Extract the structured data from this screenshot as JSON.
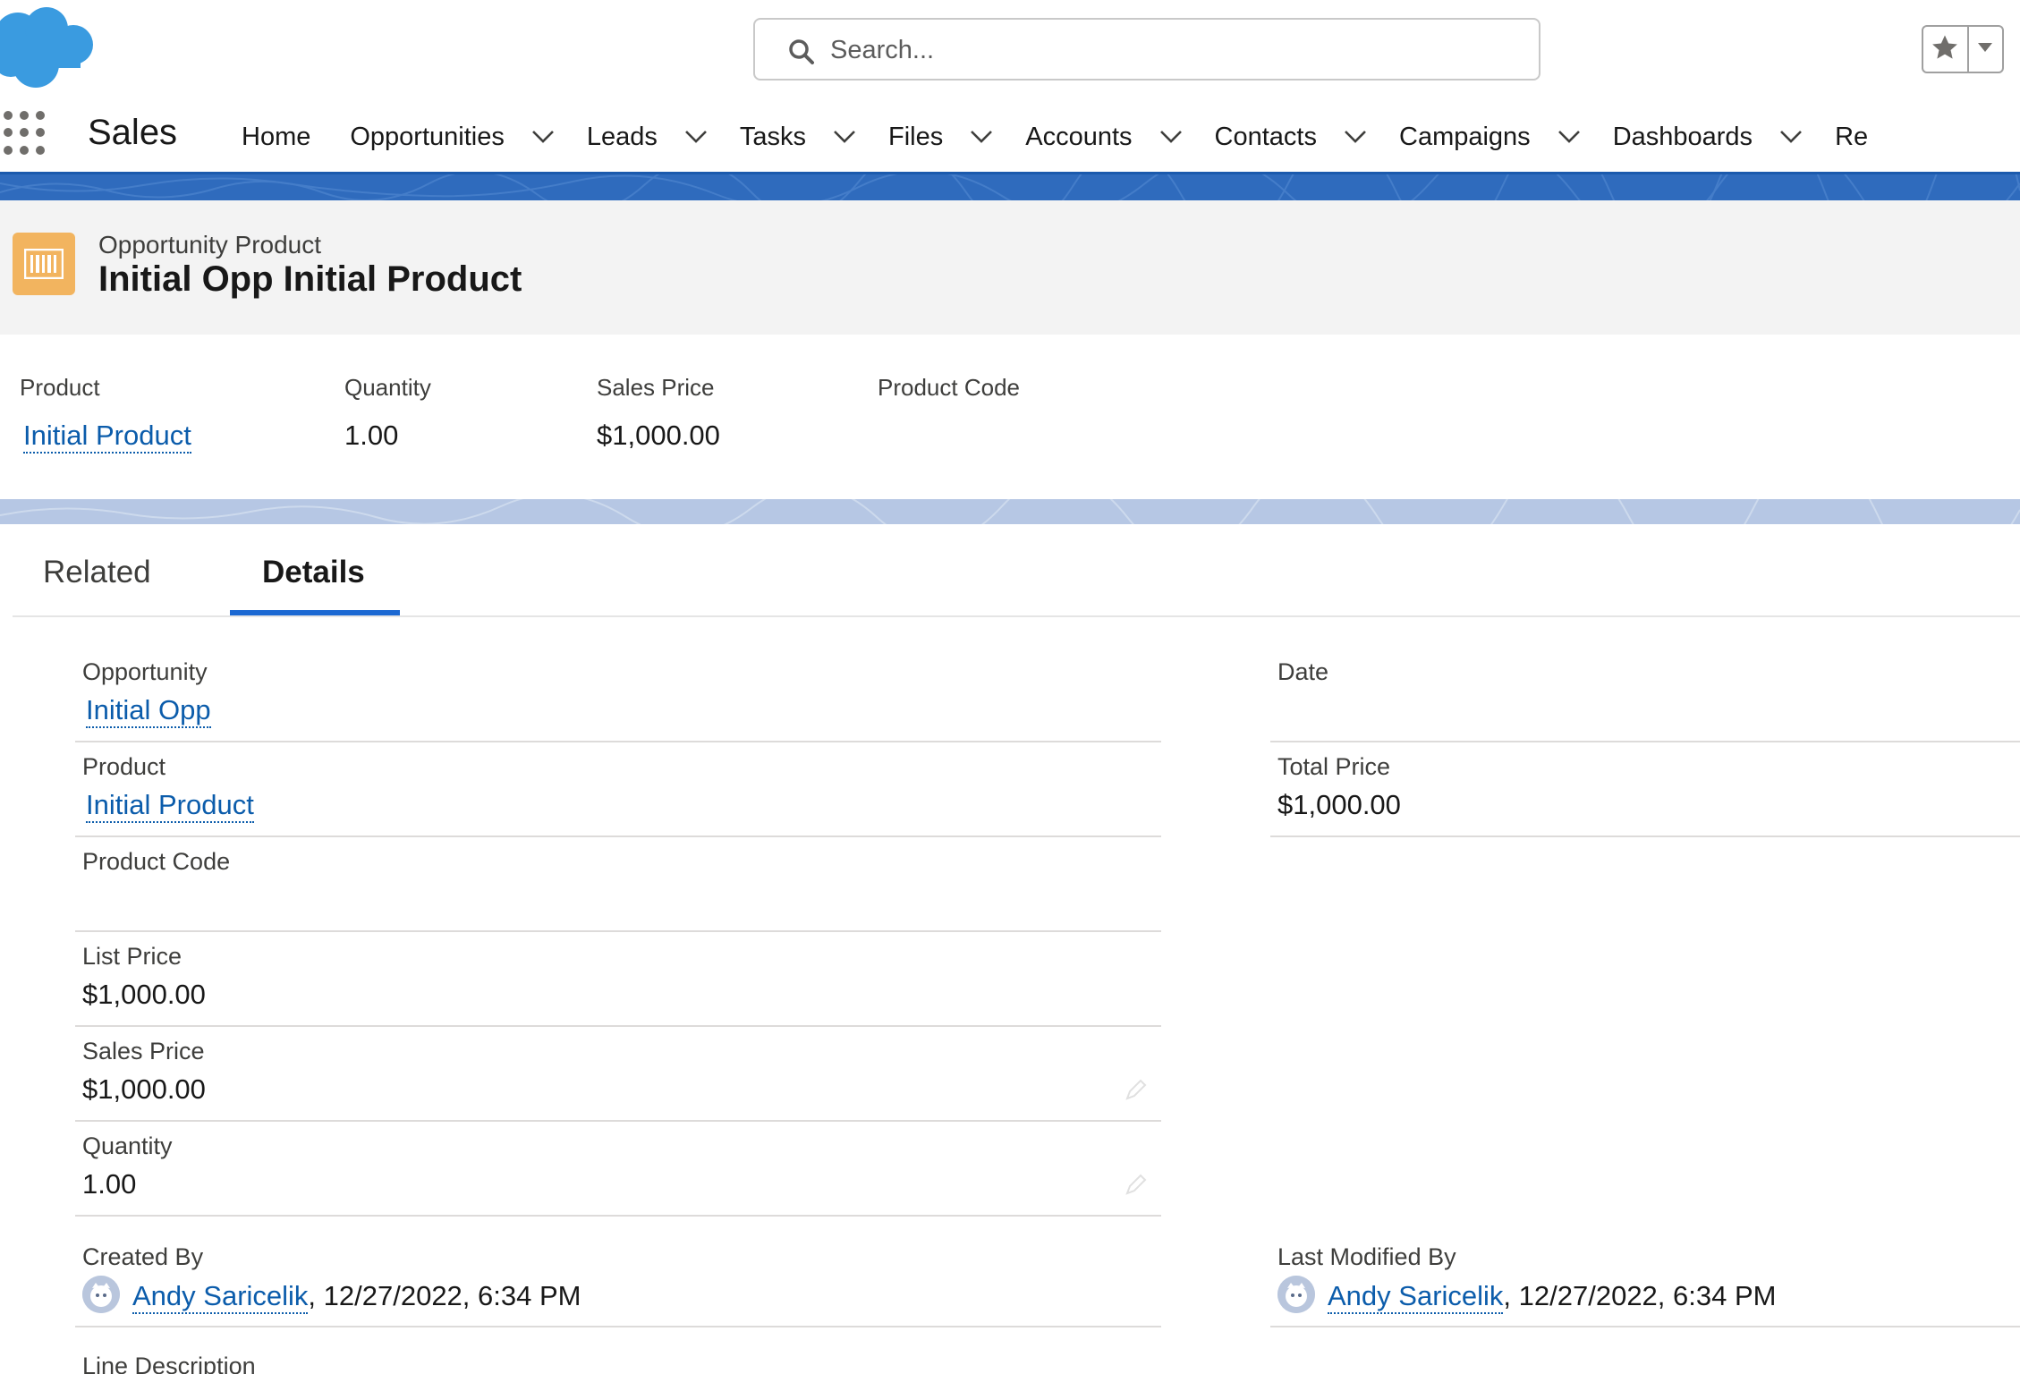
{
  "header": {
    "search_placeholder": "Search..."
  },
  "nav": {
    "app_name": "Sales",
    "items": [
      {
        "label": "Home"
      },
      {
        "label": "Opportunities"
      },
      {
        "label": "Leads"
      },
      {
        "label": "Tasks"
      },
      {
        "label": "Files"
      },
      {
        "label": "Accounts"
      },
      {
        "label": "Contacts"
      },
      {
        "label": "Campaigns"
      },
      {
        "label": "Dashboards"
      },
      {
        "label": "Re"
      }
    ]
  },
  "record": {
    "type": "Opportunity Product",
    "title": "Initial Opp Initial Product"
  },
  "highlights": {
    "product_label": "Product",
    "product_value": "Initial Product",
    "quantity_label": "Quantity",
    "quantity_value": "1.00",
    "sales_price_label": "Sales Price",
    "sales_price_value": "$1,000.00",
    "product_code_label": "Product Code"
  },
  "tabs": {
    "related": "Related",
    "details": "Details"
  },
  "details": {
    "opportunity_label": "Opportunity",
    "opportunity_value": "Initial Opp",
    "product_label": "Product",
    "product_value": "Initial Product",
    "product_code_label": "Product Code",
    "list_price_label": "List Price",
    "list_price_value": "$1,000.00",
    "sales_price_label": "Sales Price",
    "sales_price_value": "$1,000.00",
    "quantity_label": "Quantity",
    "quantity_value": "1.00",
    "created_by_label": "Created By",
    "created_by_user": "Andy Saricelik",
    "created_by_date": ", 12/27/2022, 6:34 PM",
    "date_label": "Date",
    "total_price_label": "Total Price",
    "total_price_value": "$1,000.00",
    "last_modified_label": "Last Modified By",
    "last_modified_user": "Andy Saricelik",
    "last_modified_date": ", 12/27/2022, 6:34 PM",
    "line_description_label": "Line Description"
  },
  "colors": {
    "brand_blue": "#0176d3",
    "link_blue": "#0b5cab",
    "record_icon": "#f2b45f",
    "nav_accent": "#2f6bbd"
  }
}
